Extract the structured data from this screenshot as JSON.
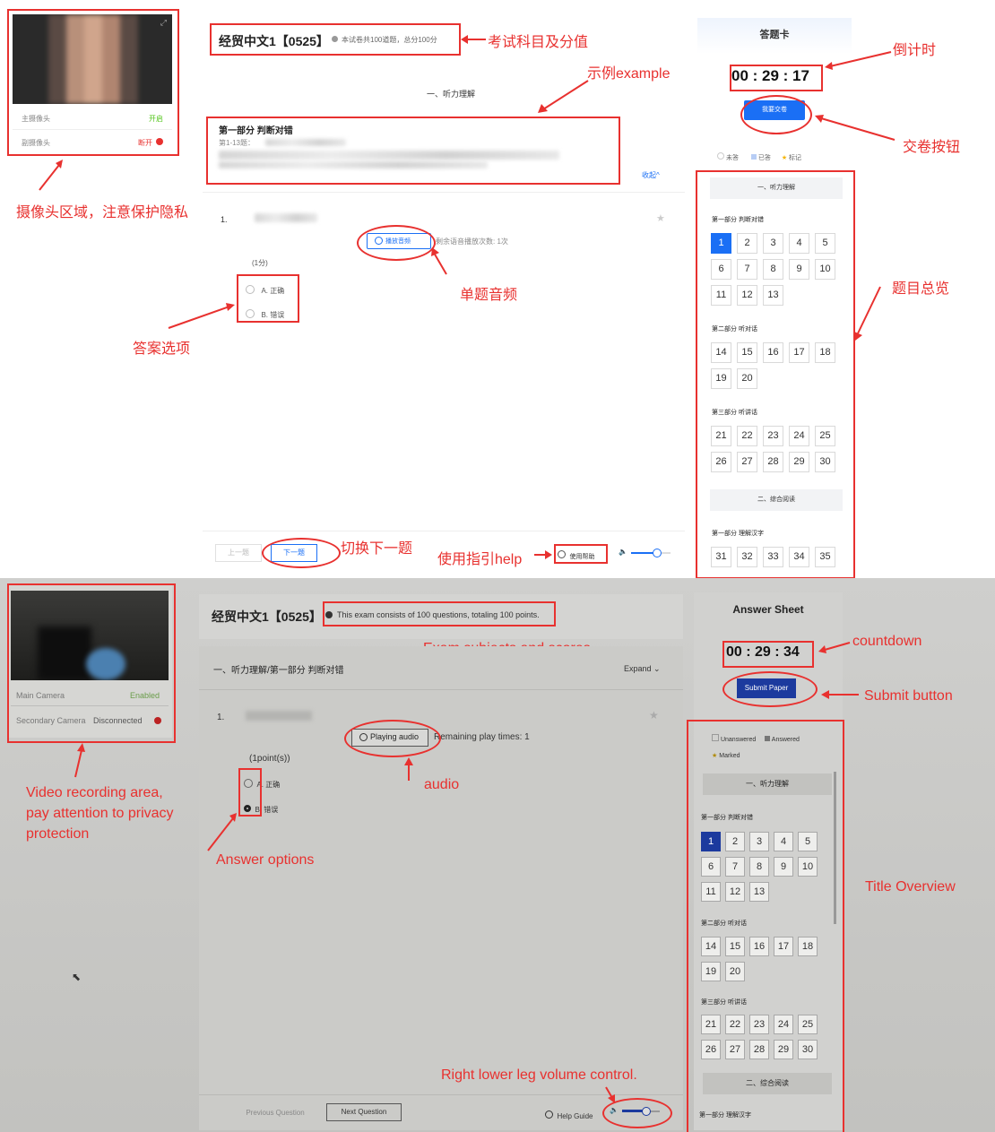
{
  "top": {
    "camera": {
      "main_label": "主摄像头",
      "main_status": "开启",
      "secondary_label": "副摄像头",
      "secondary_status": "断开"
    },
    "header": {
      "title": "经贸中文1【0525】",
      "info": "本试卷共100道题，总分100分"
    },
    "section_title": "一、听力理解",
    "part": {
      "title": "第一部分 判断对错",
      "desc": "第1-13题："
    },
    "collapse": "收起^",
    "question": {
      "number": "1.",
      "audio_button": "播放音频",
      "remaining": "剩余语音播放次数: 1次",
      "points": "(1分)",
      "options": [
        "A. 正确",
        "B. 错误"
      ]
    },
    "nav": {
      "prev": "上一题",
      "next": "下一题",
      "help": "使用帮助"
    },
    "sheet": {
      "title": "答题卡",
      "countdown": "00 : 29 : 17",
      "submit": "我要交卷",
      "legend": [
        "未答",
        "已答",
        "标记"
      ],
      "sections": [
        "一、听力理解",
        "二、综合阅读"
      ],
      "parts": [
        "第一部分 判断对错",
        "第二部分 听对话",
        "第三部分 听讲话",
        "第一部分 理解汉字"
      ],
      "part1": [
        "1",
        "2",
        "3",
        "4",
        "5",
        "6",
        "7",
        "8",
        "9",
        "10",
        "11",
        "12",
        "13"
      ],
      "part2": [
        "14",
        "15",
        "16",
        "17",
        "18",
        "19",
        "20"
      ],
      "part3": [
        "21",
        "22",
        "23",
        "24",
        "25",
        "26",
        "27",
        "28",
        "29",
        "30"
      ],
      "part4": [
        "31",
        "32",
        "33",
        "34",
        "35"
      ]
    },
    "annotations": {
      "subject": "考试科目及分值",
      "example": "示例example",
      "countdown": "倒计时",
      "submit": "交卷按钮",
      "camera": "摄像头区域，注意保护隐私",
      "audio": "单题音频",
      "options": "答案选项",
      "overview": "题目总览",
      "next": "切换下一题",
      "help": "使用指引help"
    }
  },
  "bottom": {
    "camera": {
      "main_label": "Main Camera",
      "main_status": "Enabled",
      "secondary_label": "Secondary Camera",
      "secondary_status": "Disconnected"
    },
    "header": {
      "title": "经贸中文1【0525】",
      "info": "This exam consists of 100 questions, totaling 100 points."
    },
    "section_title": "一、听力理解/第一部分 判断对错",
    "expand": "Expand",
    "question": {
      "number": "1.",
      "audio_button": "Playing audio",
      "remaining": "Remaining play times: 1",
      "points": "(1point(s))",
      "options": [
        "A. 正确",
        "B. 错误"
      ]
    },
    "nav": {
      "prev": "Previous Question",
      "next": "Next Question",
      "help": "Help Guide"
    },
    "sheet": {
      "title": "Answer Sheet",
      "countdown": "00 : 29 : 34",
      "submit": "Submit Paper",
      "legend": [
        "Unanswered",
        "Answered",
        "Marked"
      ],
      "sections": [
        "一、听力理解",
        "二、综合阅读"
      ],
      "parts": [
        "第一部分 判断对错",
        "第二部分 听对话",
        "第三部分 听讲话",
        "第一部分 理解汉字"
      ]
    },
    "annotations": {
      "subject": "Exam subjects and scores",
      "countdown": "countdown",
      "submit": "Submit button",
      "camera": "Video recording area,\npay attention to privacy\nprotection",
      "audio": "audio",
      "options": "Answer options",
      "overview": "Title Overview",
      "volume": "Right lower leg volume control."
    }
  },
  "colors": {
    "accent": "#1a6ff5",
    "annotation": "#e8312f",
    "enabled": "#52c41a",
    "disconnected": "#e8312f"
  }
}
